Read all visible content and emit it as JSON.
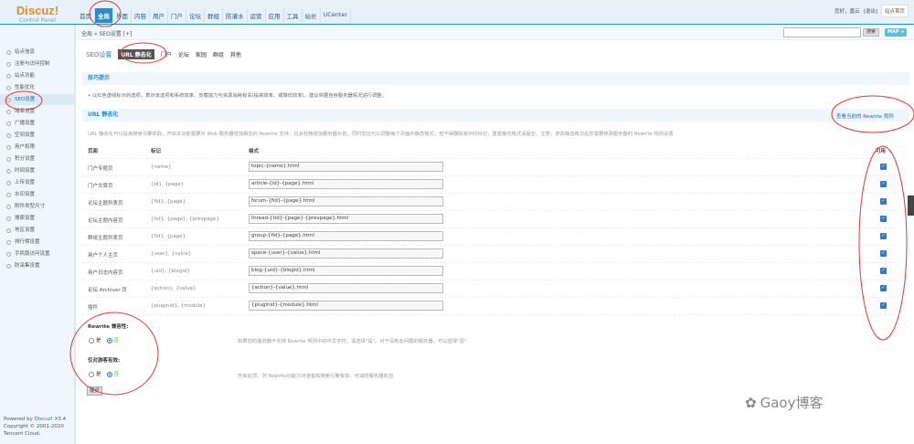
{
  "header": {
    "logo": "Discuz!",
    "logo_sub": "Control Panel",
    "nav": [
      "首页",
      "全局",
      "界面",
      "内容",
      "用户",
      "门户",
      "论坛",
      "群组",
      "防灌水",
      "运营",
      "应用",
      "工具",
      "站长",
      "UCenter"
    ],
    "active_nav": 1,
    "greeting": "您好，嘉云",
    "logout": "[退出]",
    "site_home": "站点首页"
  },
  "breadcrumb": "全局 » SEO设置",
  "breadcrumb_add": "[+]",
  "search": {
    "value": "",
    "button": "搜索",
    "map": "MAP +"
  },
  "sidebar": {
    "items": [
      "站点信息",
      "注册与访问控制",
      "站点功能",
      "性能优化",
      "SEO设置",
      "域名设置",
      "广播设置",
      "空间设置",
      "用户权限",
      "积分设置",
      "时间设置",
      "上传设置",
      "水印设置",
      "附件类型尺寸",
      "搜索设置",
      "地区设置",
      "排行榜设置",
      "手机版访问设置",
      "防采集设置"
    ],
    "active": 4
  },
  "footer": {
    "powered": "Powered by",
    "brand": "Discuz!",
    "version": "X3.4",
    "copyright": "Copyright © 2001-2020",
    "company": "Tencent Cloud."
  },
  "tabs": {
    "title": "SEO设置",
    "items": [
      "URL 静态化",
      "门户",
      "论坛",
      "家园",
      "群组",
      "其他"
    ]
  },
  "tips": {
    "title": "技巧提示",
    "text": "以红色虚线标示的选项，表示该选项和系统效率、负载能力与资源消耗有关(提高效率、或降低效率)，建议依据自身服务器情况进行调整。"
  },
  "url_section": {
    "title": "URL 静态化",
    "rewrite_link": "查看当前的 Rewrite 规则",
    "desc": "URL 静态化可以提高搜索引擎抓取，开启本功能需要对 Web 服务器增加相应的 Rewrite 支持，且会轻微增加服务器负担。同时您还可以调整每个页面的静态格式，但不得删除其中的标记，重置静态格式请留空。注意，修改静态格式后您需要修改服务器的 Rewrite 规则设置",
    "columns": [
      "页面",
      "标记",
      "格式",
      "可用"
    ],
    "rows": [
      {
        "page": "门户专题页",
        "marks": "{name}",
        "format": "topic-{name}.html",
        "enabled": true
      },
      {
        "page": "门户文章页",
        "marks": "{id}, {page}",
        "format": "article-{id}-{page}.html",
        "enabled": true
      },
      {
        "page": "论坛主题列表页",
        "marks": "{fid}, {page}",
        "format": "forum-{fid}-{page}.html",
        "enabled": true
      },
      {
        "page": "论坛主题内容页",
        "marks": "{tid}, {page}, {prevpage}",
        "format": "thread-{tid}-{page}-{prevpage}.html",
        "enabled": true
      },
      {
        "page": "群组主题列表页",
        "marks": "{fid}, {page}",
        "format": "group-{fid}-{page}.html",
        "enabled": true
      },
      {
        "page": "用户个人主页",
        "marks": "{user}, {value}",
        "format": "space-{user}-{value}.html",
        "enabled": true
      },
      {
        "page": "用户日志内容页",
        "marks": "{uid}, {blogid}",
        "format": "blog-{uid}-{blogid}.html",
        "enabled": true
      },
      {
        "page": "论坛 Archiver 页",
        "marks": "{action}, {value}",
        "format": "{action}-{value}.html",
        "enabled": true
      },
      {
        "page": "插件",
        "marks": "{pluginid}, {module}",
        "format": "{pluginid}-{module}.html",
        "enabled": true
      }
    ]
  },
  "options": [
    {
      "label": "Rewrite 兼容性:",
      "yes": "是",
      "no": "否",
      "selected": "no",
      "hint": "如果您的服务器不支持 Rewrite 规则中的中文字符，请选择\"是\"。对于没有此问题的服务器，可以选择\"否\""
    },
    {
      "label": "仅对游客有效:",
      "yes": "是",
      "no": "否",
      "selected": "no",
      "hint": "开启此项，则 Rewrite功能只对游客和搜索引擎有效，可减轻服务器负担"
    }
  ],
  "submit": "提交",
  "watermark": "Gaoy博客"
}
